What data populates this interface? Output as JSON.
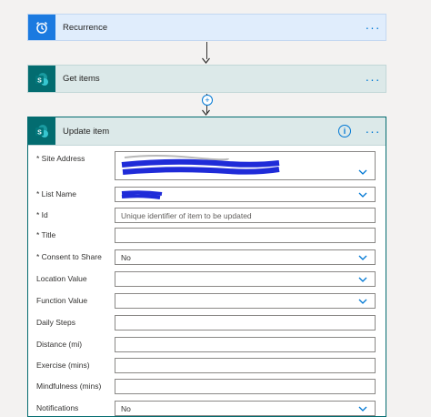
{
  "recurrence": {
    "title": "Recurrence",
    "more": "···"
  },
  "get_items": {
    "title": "Get items",
    "more": "···"
  },
  "add_step": "+",
  "update_item": {
    "title": "Update item",
    "info": "i",
    "more": "···",
    "fields": [
      {
        "label": "* Site Address",
        "value": "",
        "type": "dropdown"
      },
      {
        "label": "* List Name",
        "value": "",
        "type": "dropdown"
      },
      {
        "label": "* Id",
        "value": "Unique identifier of item to be updated",
        "type": "placeholder"
      },
      {
        "label": "* Title",
        "value": "",
        "type": "text"
      },
      {
        "label": "* Consent to Share",
        "value": "No",
        "type": "dropdown"
      },
      {
        "label": "Location Value",
        "value": "",
        "type": "dropdown"
      },
      {
        "label": "Function Value",
        "value": "",
        "type": "dropdown"
      },
      {
        "label": "Daily Steps",
        "value": "",
        "type": "text"
      },
      {
        "label": "Distance (mi)",
        "value": "",
        "type": "text"
      },
      {
        "label": "Exercise (mins)",
        "value": "",
        "type": "text"
      },
      {
        "label": "Mindfulness (mins)",
        "value": "",
        "type": "text"
      },
      {
        "label": "Notifications",
        "value": "No",
        "type": "dropdown"
      }
    ]
  },
  "colors": {
    "accent": "#0078d4",
    "sharepoint": "#036c70",
    "redaction": "#1f2bd8"
  },
  "icons": [
    "alarm-clock-icon",
    "sharepoint-icon",
    "info-icon",
    "more-icon",
    "chevron-down-icon",
    "plus-icon",
    "arrow-down-icon"
  ]
}
